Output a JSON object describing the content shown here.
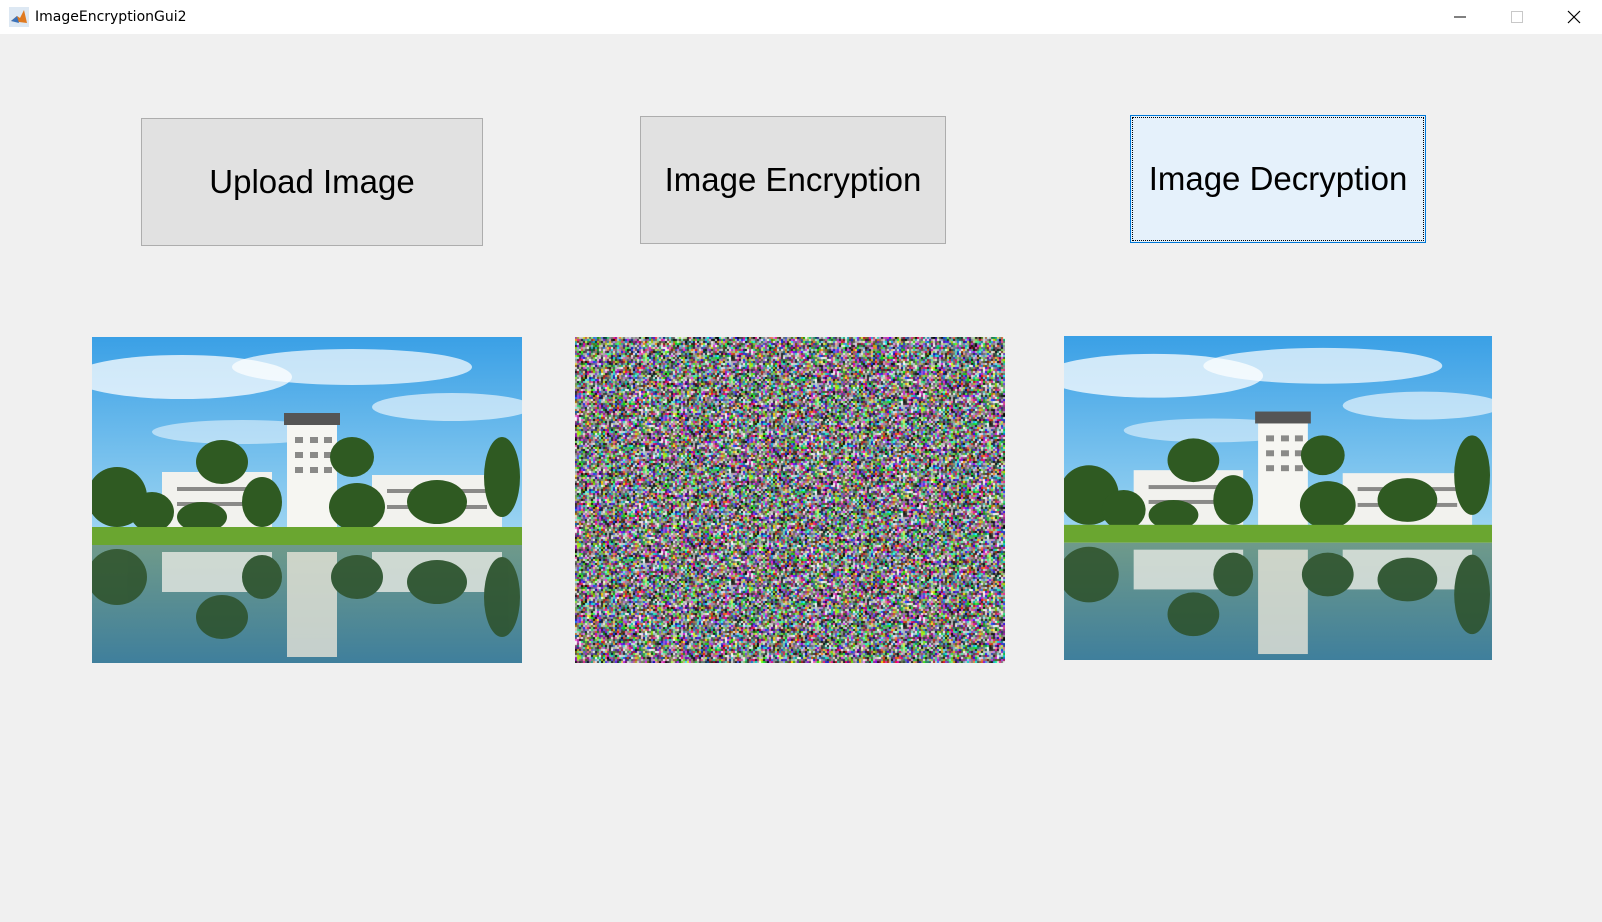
{
  "window": {
    "title": "ImageEncryptionGui2",
    "controls": [
      "minimize-icon",
      "maximize-icon",
      "close-icon"
    ]
  },
  "buttons": {
    "upload": "Upload Image",
    "encrypt": "Image Encryption",
    "decrypt": "Image Decryption"
  },
  "images": [
    {
      "name": "original-image",
      "content": "campus-building-lake-photo"
    },
    {
      "name": "encrypted-image",
      "content": "random-color-noise"
    },
    {
      "name": "decrypted-image",
      "content": "campus-building-lake-photo"
    }
  ],
  "colors": {
    "sky": "#5fb6e8",
    "grass": "#6aa630",
    "water": "#4f8aa0",
    "building": "#f4f4f0",
    "tree": "#2f5a22",
    "focus_blue": "#0078d7",
    "button_face": "#e1e1e1"
  }
}
